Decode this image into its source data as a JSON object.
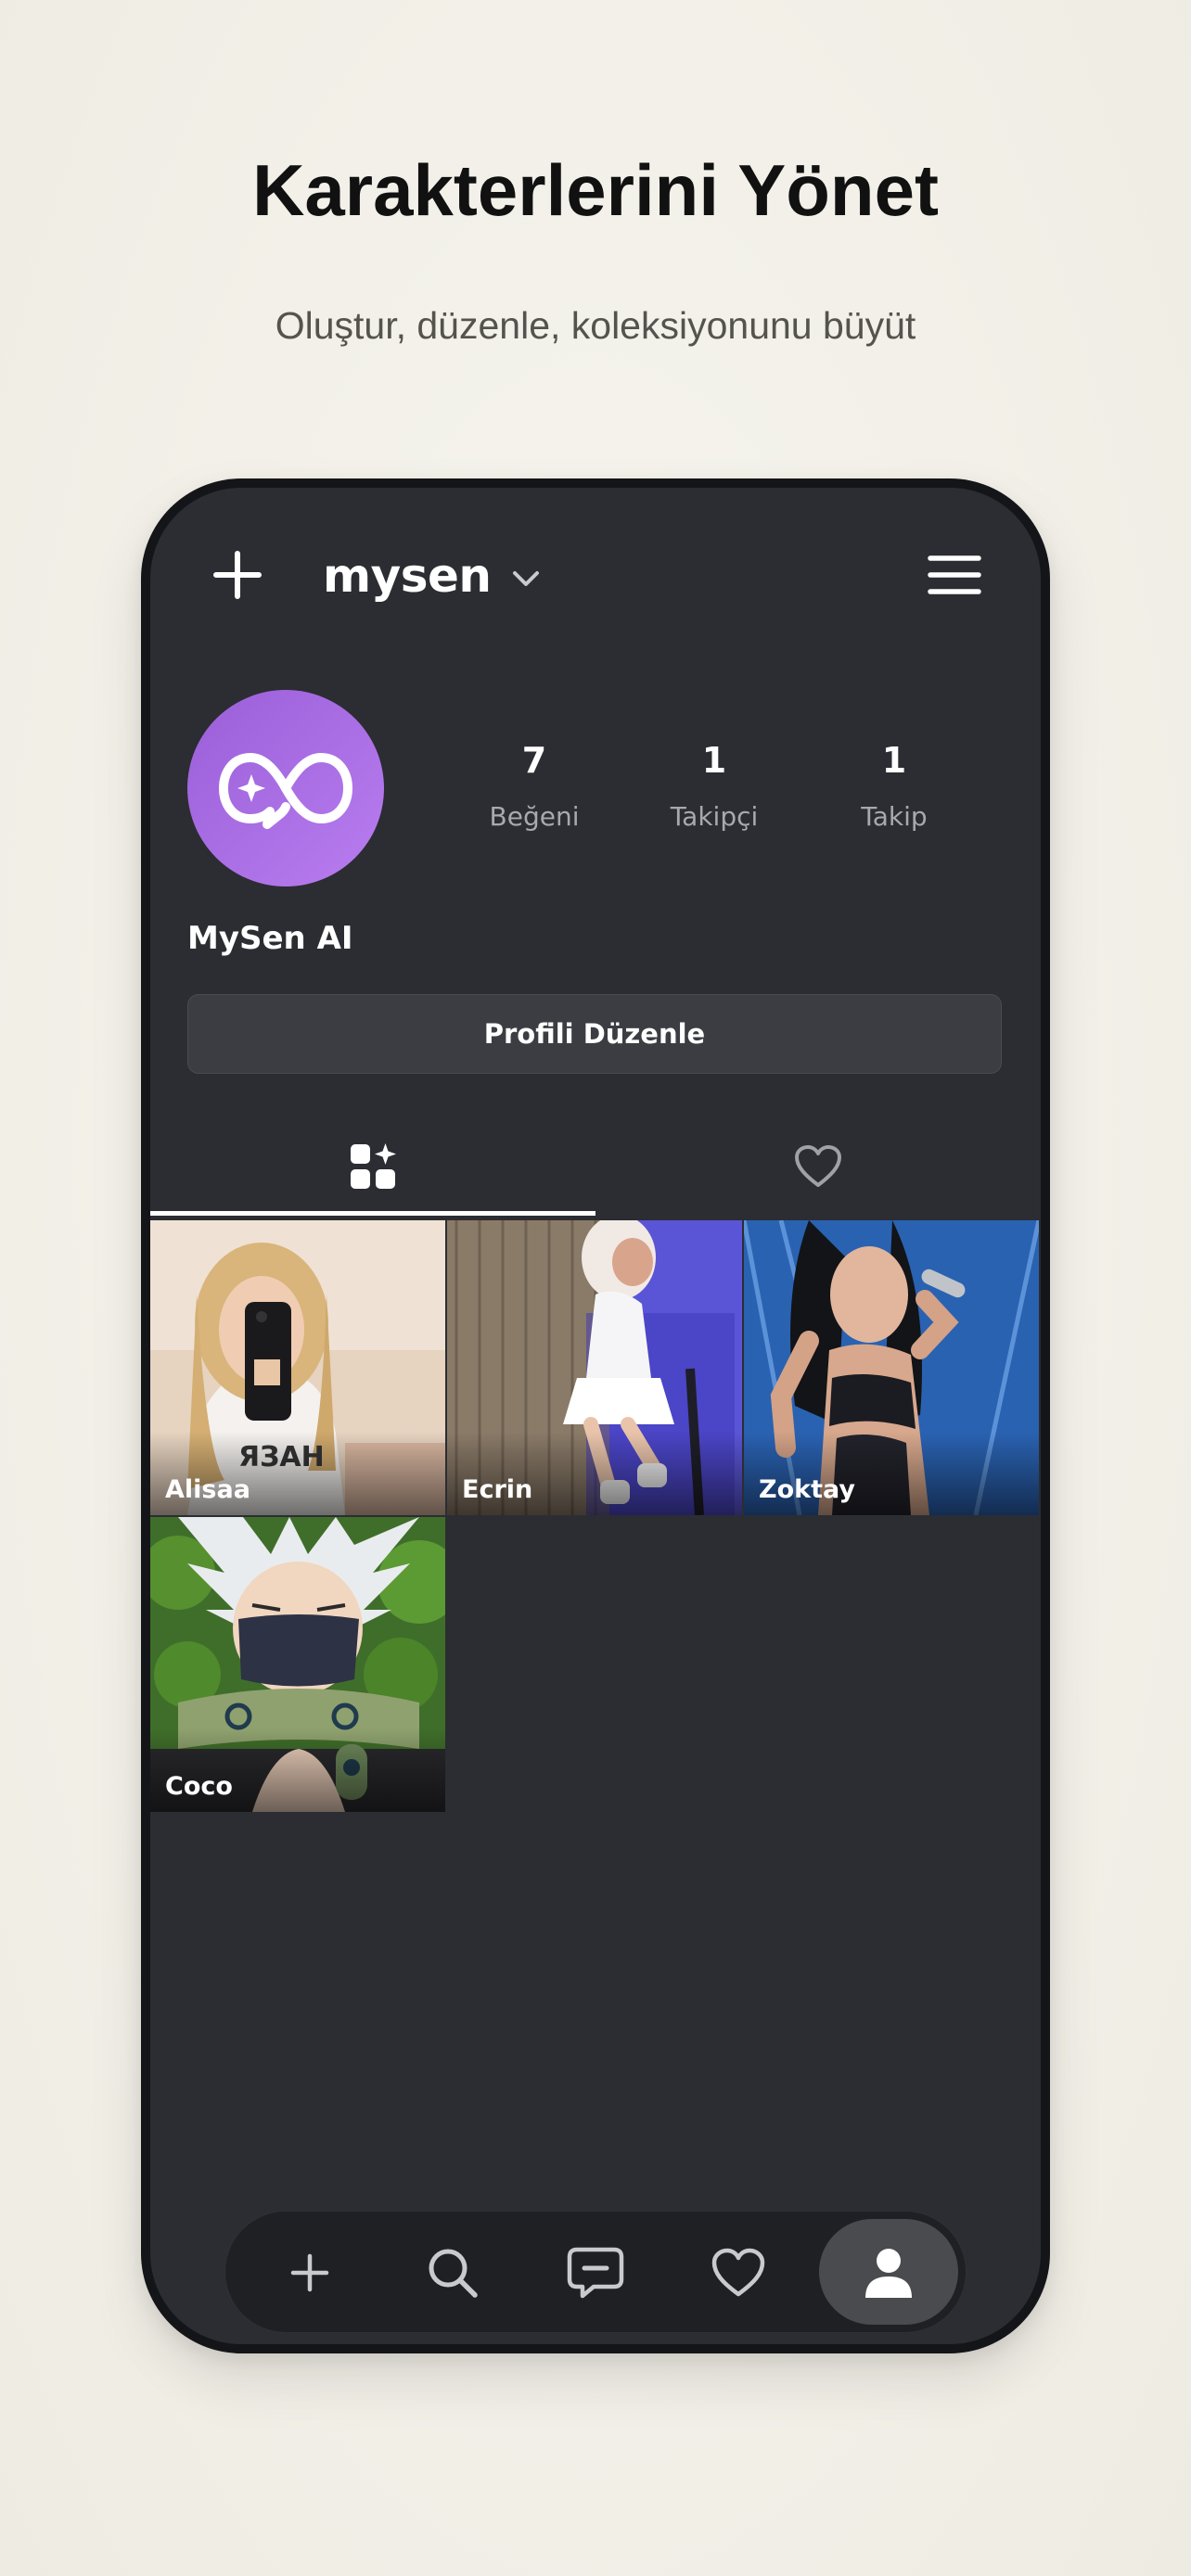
{
  "promo": {
    "title": "Karakterlerini Yönet",
    "subtitle": "Oluştur, düzenle, koleksiyonunu büyüt"
  },
  "header": {
    "username": "mysen",
    "icons": {
      "add": "plus-icon",
      "switch_account": "chevron-down-icon",
      "menu": "hamburger-menu-icon"
    }
  },
  "profile": {
    "display_name": "MySen AI",
    "avatar_icon": "infinity-sparkle-logo",
    "avatar_gradient": [
      "#9a5fd8",
      "#b97df0"
    ],
    "stats": [
      {
        "value": "7",
        "label": "Beğeni"
      },
      {
        "value": "1",
        "label": "Takipçi"
      },
      {
        "value": "1",
        "label": "Takip"
      }
    ],
    "edit_button": "Profili Düzenle"
  },
  "tabs": [
    {
      "icon": "grid-sparkle-icon",
      "selected": true
    },
    {
      "icon": "heart-icon",
      "selected": false
    }
  ],
  "characters": [
    {
      "name": "Alisaa"
    },
    {
      "name": "Ecrin"
    },
    {
      "name": "Zoktay"
    },
    {
      "name": "Coco"
    }
  ],
  "bottom_nav": [
    {
      "icon": "plus-icon",
      "active": false
    },
    {
      "icon": "search-icon",
      "active": false
    },
    {
      "icon": "chat-icon",
      "active": false
    },
    {
      "icon": "heart-icon",
      "active": false
    },
    {
      "icon": "profile-icon",
      "active": true
    }
  ],
  "colors": {
    "page_background": "#f2f0e8",
    "screen_background": "#2b2d32",
    "accent": "#b07ae8",
    "muted_text": "#a8a9ad"
  }
}
